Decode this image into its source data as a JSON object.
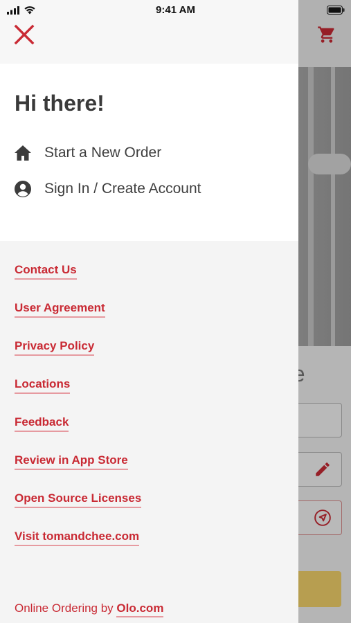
{
  "status_bar": {
    "time": "9:41 AM"
  },
  "drawer": {
    "greeting": "Hi there!",
    "menu": [
      {
        "label": "Start a New Order",
        "icon": "home-icon"
      },
      {
        "label": "Sign In / Create Account",
        "icon": "account-circle-icon"
      }
    ],
    "links": [
      "Contact Us",
      "User Agreement",
      "Privacy Policy",
      "Locations",
      "Feedback",
      "Review in App Store",
      "Open Source Licenses",
      "Visit tomandchee.com"
    ],
    "footer": {
      "prefix": "Online Ordering by",
      "link": "Olo.com"
    }
  },
  "background": {
    "title_fragment": "ee"
  },
  "colors": {
    "accent": "#c92a34",
    "link_underline": "#e69aa0",
    "text_dark": "#3a3a3a",
    "drawer_bg": "#f4f4f4",
    "button_yellow": "#f5d36b"
  }
}
